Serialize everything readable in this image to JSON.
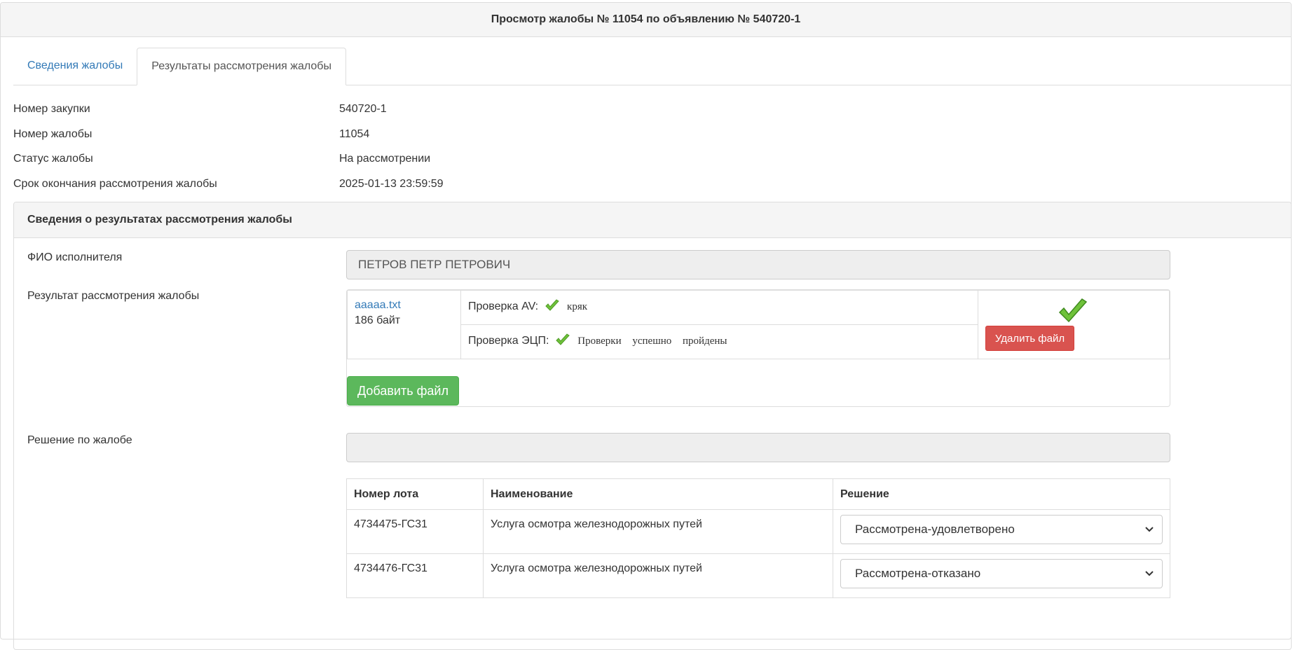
{
  "header": {
    "title": "Просмотр жалобы № 11054 по объявлению № 540720-1"
  },
  "tabs": [
    {
      "label": "Сведения жалобы",
      "active": false
    },
    {
      "label": "Результаты рассмотрения жалобы",
      "active": true
    }
  ],
  "info": [
    {
      "label": "Номер закупки",
      "value": "540720-1"
    },
    {
      "label": "Номер жалобы",
      "value": "11054"
    },
    {
      "label": "Статус жалобы",
      "value": "На рассмотрении"
    },
    {
      "label": "Срок окончания рассмотрения жалобы",
      "value": "2025-01-13 23:59:59"
    }
  ],
  "panel": {
    "title": "Сведения о результатах рассмотрения жалобы",
    "executor_label": "ФИО исполнителя",
    "executor_value": "ПЕТРОВ ПЕТР ПЕТРОВИЧ",
    "result_label": "Результат рассмотрения жалобы",
    "file": {
      "name": "aaaaa.txt",
      "size": "186 байт",
      "av_label": "Проверка AV:",
      "av_result": "кряк",
      "sig_label": "Проверка ЭЦП:",
      "sig_result": "Проверки успешно пройдены",
      "delete_label": "Удалить файл"
    },
    "add_file_label": "Добавить файл",
    "decision_label": "Решение по жалобе",
    "decision_value": "",
    "lots": {
      "headers": [
        "Номер лота",
        "Наименование",
        "Решение"
      ],
      "rows": [
        {
          "lot": "4734475-ГС31",
          "name": "Услуга осмотра железнодорожных путей",
          "decision": "Рассмотрена-удовлетворено"
        },
        {
          "lot": "4734476-ГС31",
          "name": "Услуга осмотра железнодорожных путей",
          "decision": "Рассмотрена-отказано"
        }
      ]
    }
  },
  "colors": {
    "link": "#337ab7",
    "success": "#5cb85c",
    "danger": "#d9534f",
    "check": "#6fc23a"
  }
}
